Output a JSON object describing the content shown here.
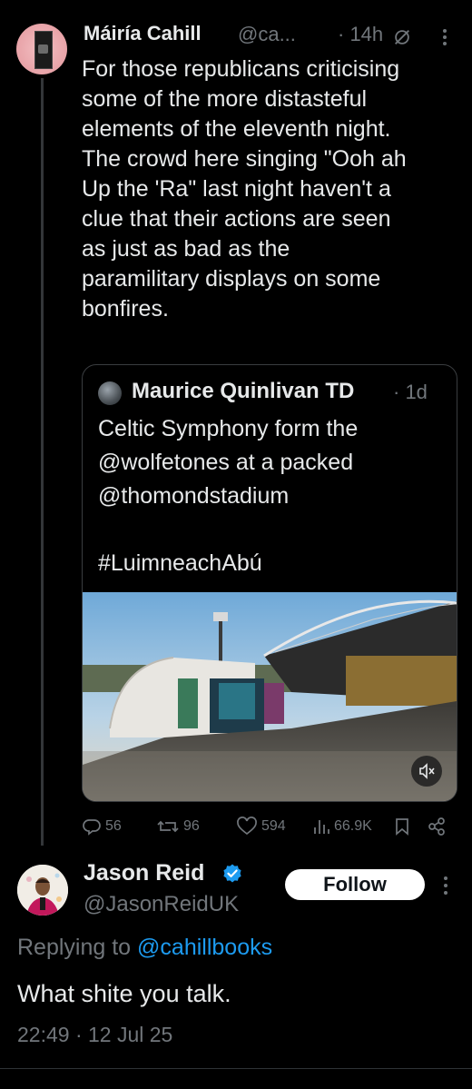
{
  "parent_tweet": {
    "name": "Máiría Cahill",
    "handle": "@ca...",
    "time": "· 14h",
    "text": "For those republicans criticising\nsome of the more distasteful\nelements of the eleventh night.\nThe crowd here singing \"Ooh ah\nUp the 'Ra\" last night haven't a\nclue that their actions are seen\nas just as bad as the\nparamilitary displays on some\nbonfires.",
    "quote": {
      "name": "Maurice Quinlivan TD",
      "time": "· 1d",
      "text": "Celtic Symphony form the\n@wolfetones at a packed\n@thomondstadium\n\n#LuimneachAbú"
    },
    "actions": {
      "replies": "56",
      "reposts": "96",
      "likes": "594",
      "views": "66.9K"
    }
  },
  "reply_tweet": {
    "name": "Jason Reid",
    "handle": "@JasonReidUK",
    "follow_label": "Follow",
    "replying_prefix": "Replying to",
    "replying_handle": "@cahillbooks",
    "text": "What shite you talk.",
    "timestamp": "22:49 · 12 Jul 25"
  },
  "colors": {
    "background": "#000000",
    "text": "#e7e9ea",
    "muted": "#71767b",
    "link": "#1d9bf0",
    "verified": "#1d9bf0",
    "border": "#2f3336"
  },
  "icons": {
    "reply": "reply-icon",
    "repost": "repost-icon",
    "like": "like-icon",
    "views": "views-icon",
    "bookmark": "bookmark-icon",
    "share": "share-icon",
    "grok": "grok-icon",
    "more": "more-icon",
    "mute": "mute-icon",
    "verified": "verified-icon"
  }
}
